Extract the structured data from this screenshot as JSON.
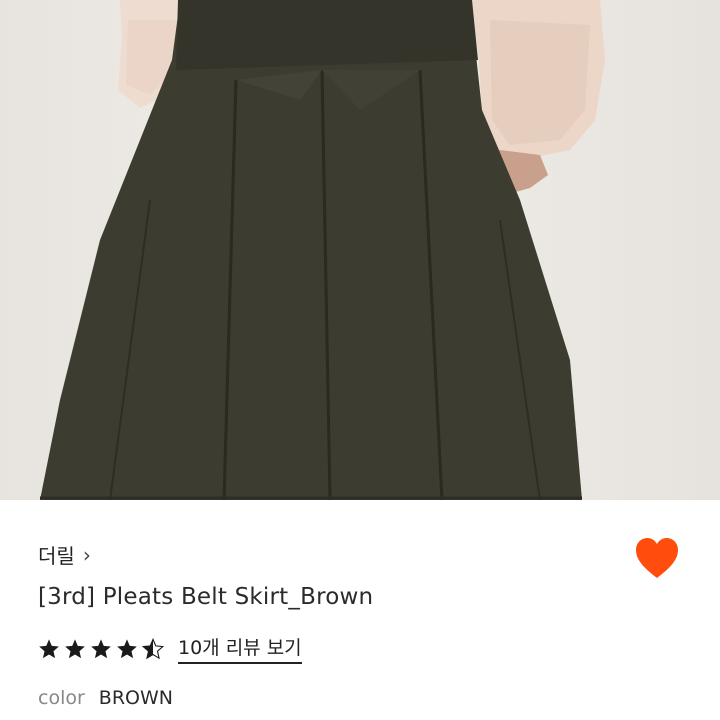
{
  "product": {
    "image_alt": "product-photo",
    "brand": "더릴",
    "brand_chevron": "›",
    "title": "[3rd] Pleats Belt Skirt_Brown",
    "rating": 4.5,
    "review_link": "10개 리뷰 보기",
    "option_label": "color",
    "option_value": "BROWN"
  },
  "icons": {
    "wishlist": "heart-icon",
    "rating": "star-icon"
  },
  "colors": {
    "heart": "#FF4D0D",
    "star": "#1a1a1a",
    "skirt": "#3c3b30",
    "sweater": "#ecd8cb"
  }
}
